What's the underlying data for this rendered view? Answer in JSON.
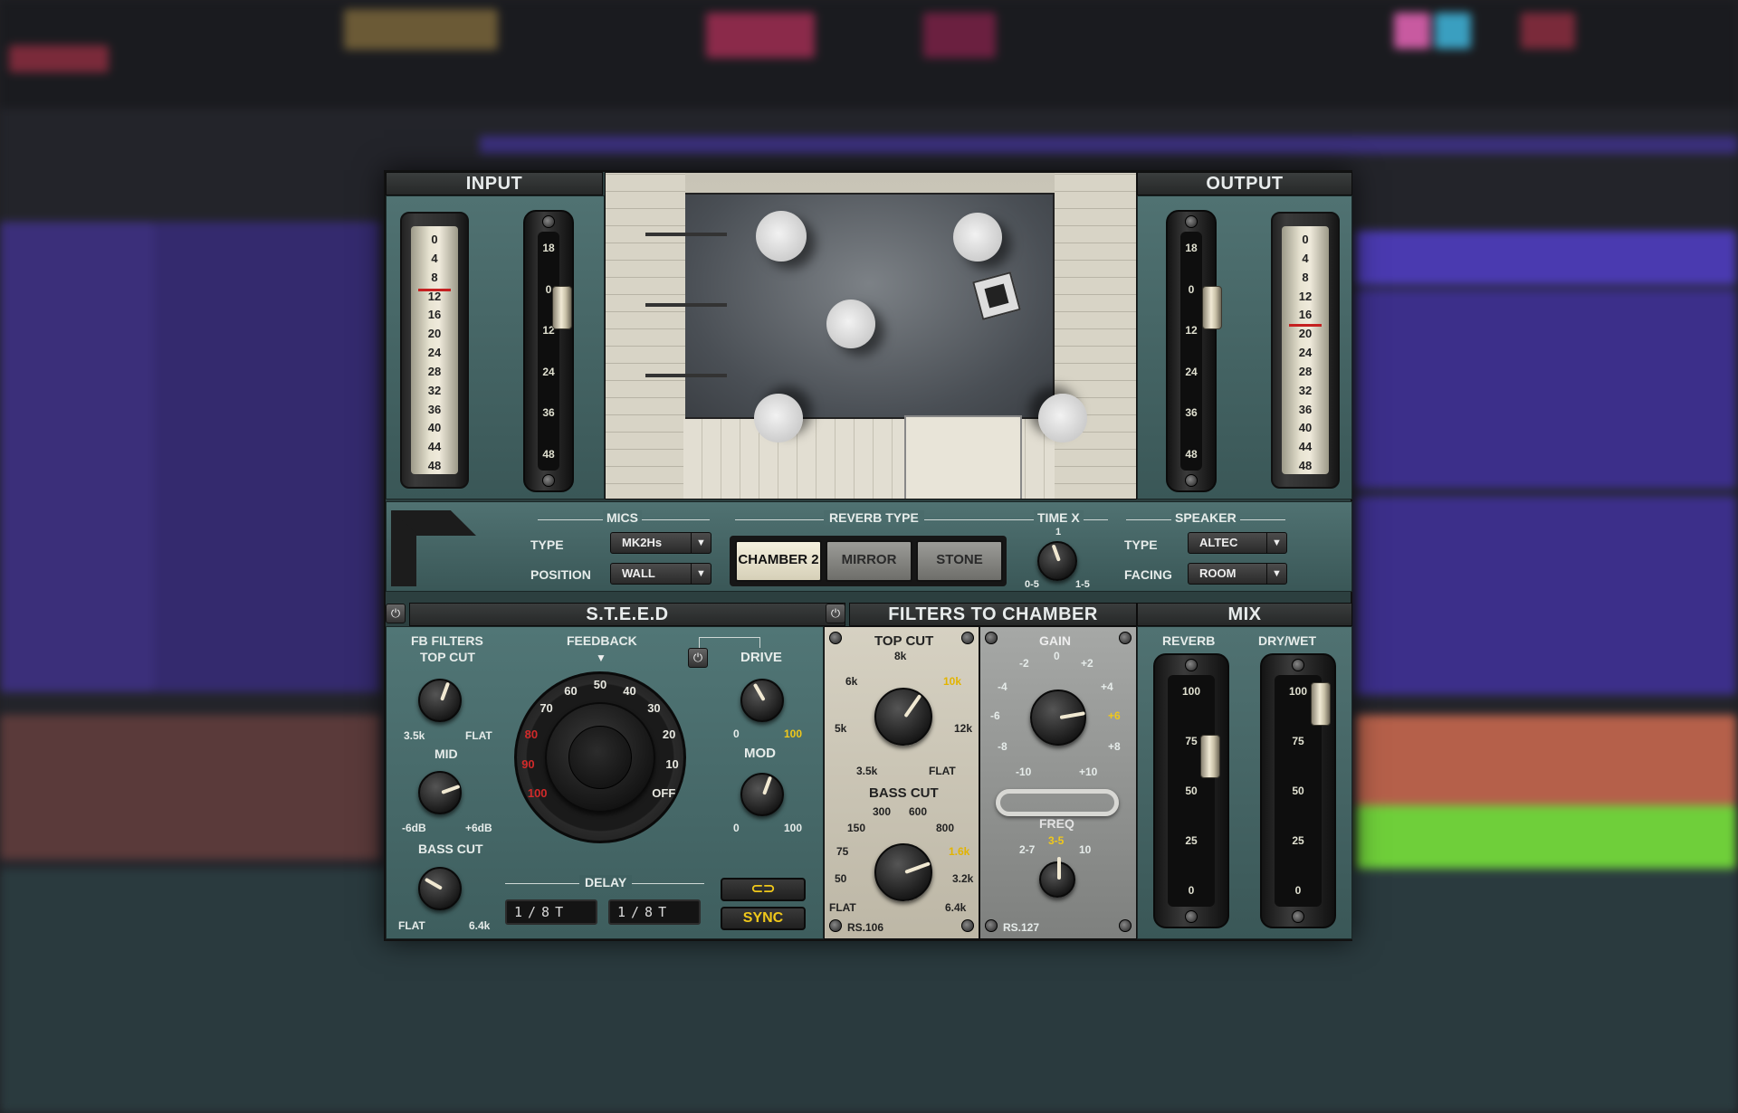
{
  "input": {
    "title": "INPUT",
    "meter_ticks": [
      "0",
      "4",
      "8",
      "12",
      "16",
      "20",
      "24",
      "28",
      "32",
      "36",
      "40",
      "44",
      "48"
    ],
    "fader_ticks": [
      "18",
      "0",
      "12",
      "24",
      "36",
      "48"
    ],
    "fader_value_db": 0
  },
  "output": {
    "title": "OUTPUT",
    "meter_ticks": [
      "0",
      "4",
      "8",
      "12",
      "16",
      "20",
      "24",
      "28",
      "32",
      "36",
      "40",
      "44",
      "48"
    ],
    "fader_ticks": [
      "18",
      "0",
      "12",
      "24",
      "36",
      "48"
    ],
    "fader_value_db": 0
  },
  "mics": {
    "section_label": "MICS",
    "type_label": "TYPE",
    "type_value": "MK2Hs",
    "position_label": "POSITION",
    "position_value": "WALL"
  },
  "reverb_type": {
    "section_label": "REVERB TYPE",
    "options": [
      "CHAMBER 2",
      "MIRROR",
      "STONE"
    ],
    "selected": "CHAMBER 2"
  },
  "time_x": {
    "section_label": "TIME X",
    "top": "1",
    "left": "0-5",
    "right": "1-5"
  },
  "speaker": {
    "section_label": "SPEAKER",
    "type_label": "TYPE",
    "type_value": "ALTEC",
    "facing_label": "FACING",
    "facing_value": "ROOM"
  },
  "steed": {
    "title": "S.T.E.E.D",
    "fb_filters_label": "FB FILTERS",
    "top_cut_label": "TOP CUT",
    "top_cut_min": "3.5k",
    "top_cut_max": "FLAT",
    "mid_label": "MID",
    "mid_min": "-6dB",
    "mid_max": "+6dB",
    "bass_cut_label": "BASS CUT",
    "bass_cut_min": "FLAT",
    "bass_cut_max": "6.4k",
    "feedback_label": "FEEDBACK",
    "feedback_ticks": [
      "OFF",
      "10",
      "20",
      "30",
      "40",
      "50",
      "60",
      "70",
      "80",
      "90",
      "100"
    ],
    "drive_label": "DRIVE",
    "drive_min": "0",
    "drive_max": "100",
    "mod_label": "MOD",
    "mod_min": "0",
    "mod_max": "100",
    "delay_label": "DELAY",
    "delay_left": "1/8T",
    "delay_right": "1/8T",
    "sync_label": "SYNC"
  },
  "filters": {
    "title": "FILTERS TO CHAMBER",
    "top_cut_label": "TOP CUT",
    "top_cut_ticks": [
      "8k",
      "10k",
      "6k",
      "5k",
      "12k",
      "3.5k",
      "FLAT"
    ],
    "bass_cut_label": "BASS CUT",
    "bass_cut_ticks": [
      "300",
      "600",
      "150",
      "800",
      "75",
      "1.6k",
      "50",
      "3.2k",
      "FLAT",
      "6.4k"
    ],
    "rs_left": "RS.106",
    "gain_label": "GAIN",
    "gain_ticks": [
      "0",
      "-2",
      "+2",
      "-4",
      "+4",
      "-6",
      "+6",
      "-8",
      "+8",
      "-10",
      "+10"
    ],
    "freq_label": "FREQ",
    "freq_ticks": [
      "2-7",
      "3-5",
      "10"
    ],
    "rs_right": "RS.127"
  },
  "mix": {
    "title": "MIX",
    "reverb_label": "REVERB",
    "drywet_label": "DRY/WET",
    "fader_ticks": [
      "100",
      "75",
      "50",
      "25",
      "0"
    ],
    "reverb_value": 75,
    "drywet_value": 100
  },
  "colors": {
    "accent_yellow": "#f0c81a",
    "panel_teal": "#456565",
    "meter_red": "#c52020"
  },
  "icons": [
    "power-icon",
    "link-icon",
    "dropdown-arrow-icon",
    "waves-logo-icon"
  ]
}
